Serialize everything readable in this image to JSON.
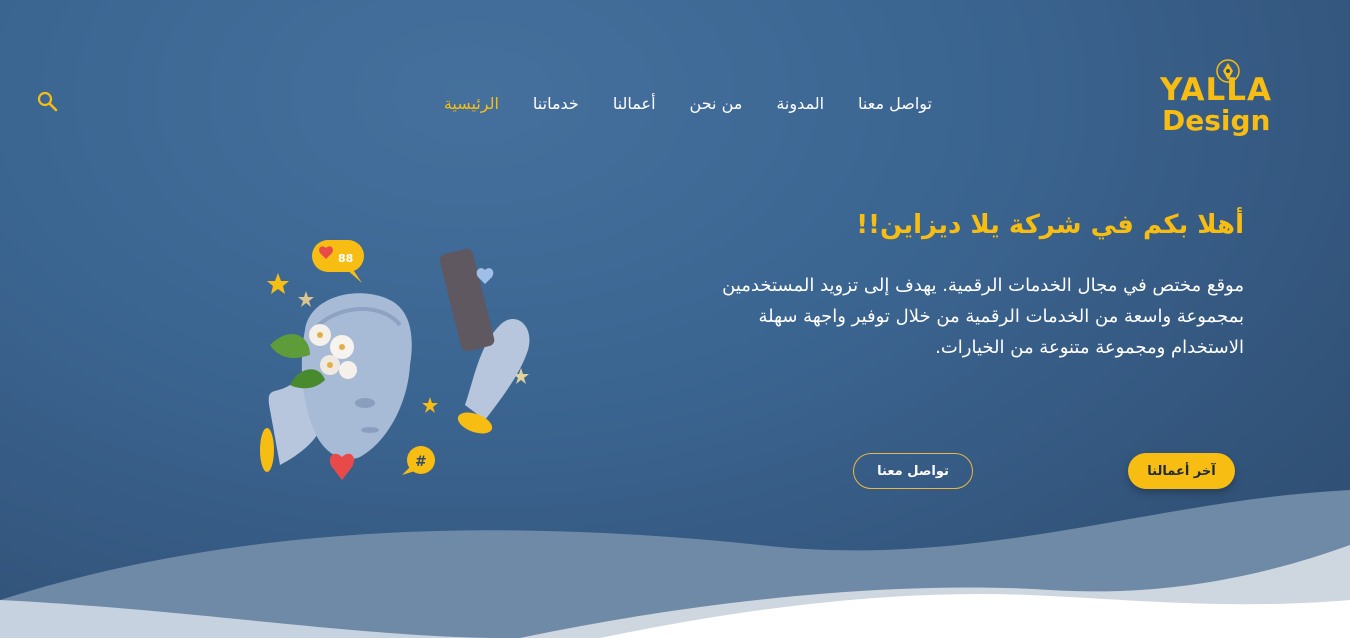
{
  "brand": {
    "logo_line1": "YALLA",
    "logo_line2": "Design",
    "color": "#f7bd13"
  },
  "nav": {
    "items": [
      {
        "label": "الرئيسية",
        "active": true
      },
      {
        "label": "خدماتنا",
        "active": false
      },
      {
        "label": "أعمالنا",
        "active": false
      },
      {
        "label": "من نحن",
        "active": false
      },
      {
        "label": "المدونة",
        "active": false
      },
      {
        "label": "تواصل معنا",
        "active": false
      }
    ],
    "search_icon": "search-icon"
  },
  "hero": {
    "title": "أهلا بكم في شركة يلا ديزاين!!",
    "description": "موقع مختص في مجال الخدمات الرقمية. يهدف إلى تزويد المستخدمين بمجموعة واسعة من الخدمات الرقمية من خلال توفير واجهة سهلة الاستخدام ومجموعة متنوعة من الخيارات.",
    "primary_button": "آخر أعمالنا",
    "secondary_button": "تواصل معنا"
  },
  "illustration": {
    "like_count": "88",
    "hashtag": "#"
  },
  "colors": {
    "accent": "#f7bd13",
    "background": "#3b6591",
    "text": "#ffffff"
  }
}
